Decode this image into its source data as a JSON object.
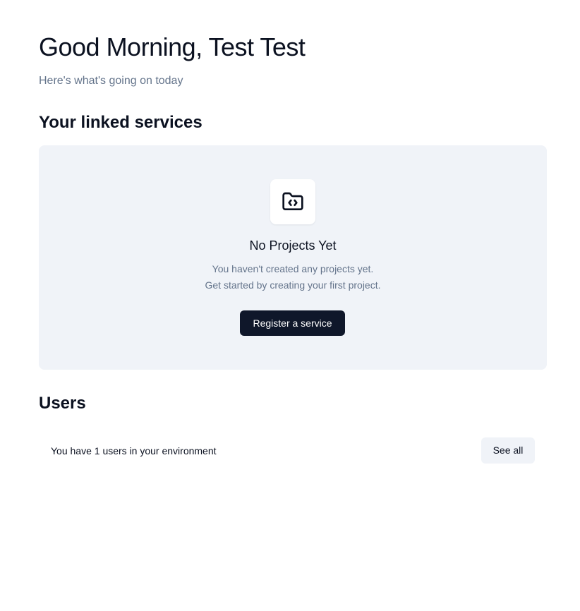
{
  "header": {
    "greeting": "Good Morning, Test Test",
    "subtitle": "Here's what's going on today"
  },
  "services": {
    "title": "Your linked services",
    "empty_state": {
      "icon": "folder-code-icon",
      "title": "No Projects Yet",
      "line1": "You haven't created any projects yet.",
      "line2": "Get started by creating your first project.",
      "button_label": "Register a service"
    }
  },
  "users": {
    "title": "Users",
    "summary": "You have 1 users in your environment",
    "see_all_label": "See all"
  },
  "colors": {
    "primary": "#0f172a",
    "muted_text": "#64748b",
    "card_background": "#f0f3f8"
  }
}
